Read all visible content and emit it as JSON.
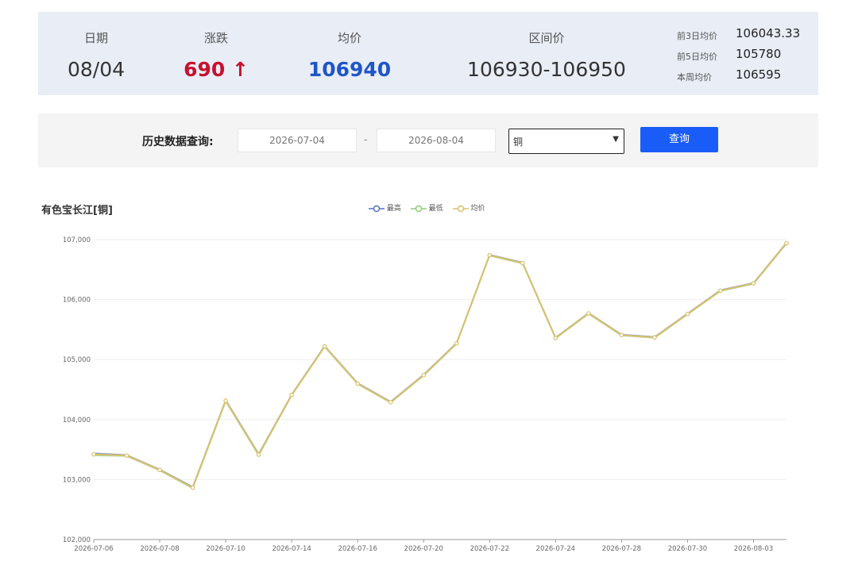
{
  "summary": {
    "date_label": "日期",
    "date_value": "08/04",
    "change_label": "涨跌",
    "change_value": "690 ↑",
    "avg_label": "均价",
    "avg_value": "106940",
    "range_label": "区间价",
    "range_value": "106930-106950",
    "side": [
      {
        "label": "前3日均价",
        "value": "106043.33"
      },
      {
        "label": "前5日均价",
        "value": "105780"
      },
      {
        "label": "本周均价",
        "value": "106595"
      }
    ],
    "colors": {
      "up": "#c8102e",
      "avg": "#1f55c8"
    }
  },
  "query": {
    "label": "历史数据查询:",
    "from_date": "2026-07-04",
    "dash": "-",
    "to_date": "2026-08-04",
    "select_value": "铜",
    "button_label": "查询",
    "button_color": "#1a5cf7"
  },
  "chart_data": {
    "type": "line",
    "title": "有色宝长江[铜]",
    "legend": [
      "最高",
      "最低",
      "均价"
    ],
    "legend_colors": [
      "#5470c6",
      "#91cc75",
      "#d8c06a"
    ],
    "legend_position": "top-center",
    "x": [
      "2026-07-06",
      "2026-07-07",
      "2026-07-08",
      "2026-07-09",
      "2026-07-10",
      "2026-07-13",
      "2026-07-14",
      "2026-07-15",
      "2026-07-16",
      "2026-07-17",
      "2026-07-20",
      "2026-07-21",
      "2026-07-22",
      "2026-07-23",
      "2026-07-24",
      "2026-07-27",
      "2026-07-28",
      "2026-07-29",
      "2026-07-30",
      "2026-07-31",
      "2026-08-03",
      "2026-08-04"
    ],
    "x_tick_labels": [
      "2026-07-06",
      "2026-07-08",
      "2026-07-10",
      "2026-07-14",
      "2026-07-16",
      "2026-07-20",
      "2026-07-22",
      "2026-07-24",
      "2026-07-28",
      "2026-07-30",
      "2026-08-03"
    ],
    "series": [
      {
        "name": "最高",
        "values": [
          103440,
          103410,
          103170,
          102880,
          104330,
          103430,
          104420,
          105230,
          104610,
          104300,
          104750,
          105280,
          106750,
          106620,
          105370,
          105780,
          105420,
          105380,
          105770,
          106160,
          106280,
          106950
        ]
      },
      {
        "name": "最低",
        "values": [
          103400,
          103390,
          103150,
          102850,
          104300,
          103400,
          104400,
          105210,
          104590,
          104280,
          104730,
          105260,
          106730,
          106600,
          105350,
          105760,
          105400,
          105360,
          105750,
          106140,
          106260,
          106930
        ]
      },
      {
        "name": "均价",
        "values": [
          103420,
          103400,
          103160,
          102865,
          104315,
          103415,
          104410,
          105220,
          104600,
          104290,
          104740,
          105270,
          106740,
          106610,
          105360,
          105770,
          105410,
          105370,
          105760,
          106150,
          106270,
          106940
        ]
      }
    ],
    "ylim": [
      102000,
      107000
    ],
    "y_ticks": [
      "102,000",
      "103,000",
      "104,000",
      "105,000",
      "106,000",
      "107,000"
    ],
    "grid": true
  }
}
